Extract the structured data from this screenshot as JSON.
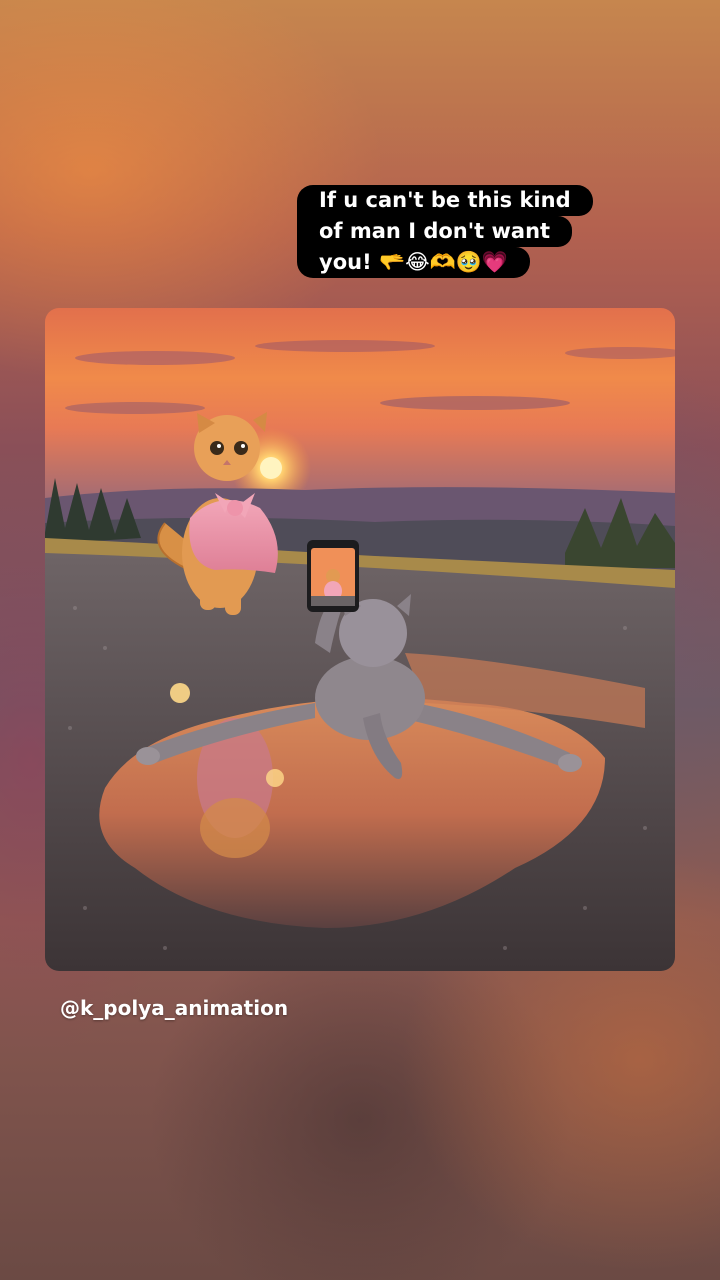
{
  "caption": {
    "lines": [
      "If u can't be this kind",
      "of man I don't want",
      "you! 🫳😂🫶🥹💗"
    ]
  },
  "photo": {
    "description_icon": "kittens-sunset-photo-icon"
  },
  "credit": {
    "handle": "@k_polya_animation"
  }
}
